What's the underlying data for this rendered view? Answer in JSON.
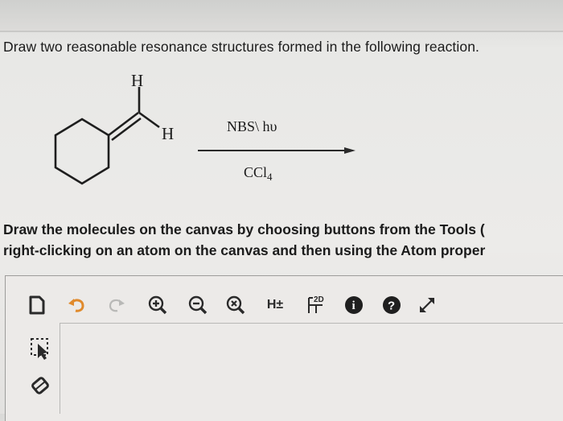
{
  "question": {
    "text": "Draw two reasonable resonance structures formed in the following reaction."
  },
  "reaction": {
    "atom_h_top": "H",
    "atom_h_right": "H",
    "reagent_top": "NBS\\ hυ",
    "reagent_bottom_main": "CCl",
    "reagent_bottom_subscript": "4"
  },
  "instructions": {
    "line1": "Draw the molecules on the canvas by choosing buttons from the Tools (",
    "line2": "right-clicking on an atom on the canvas and then using the Atom proper"
  },
  "toolbar": {
    "hydrogen_toggle_label": "H±",
    "view_2d_label": "2D",
    "info_label": "i",
    "help_label": "?"
  },
  "colors": {
    "page_bg": "#ecebe9",
    "text": "#1b1b1b",
    "undo_orange": "#e08a2c",
    "icon_dark": "#2a2a2a"
  }
}
